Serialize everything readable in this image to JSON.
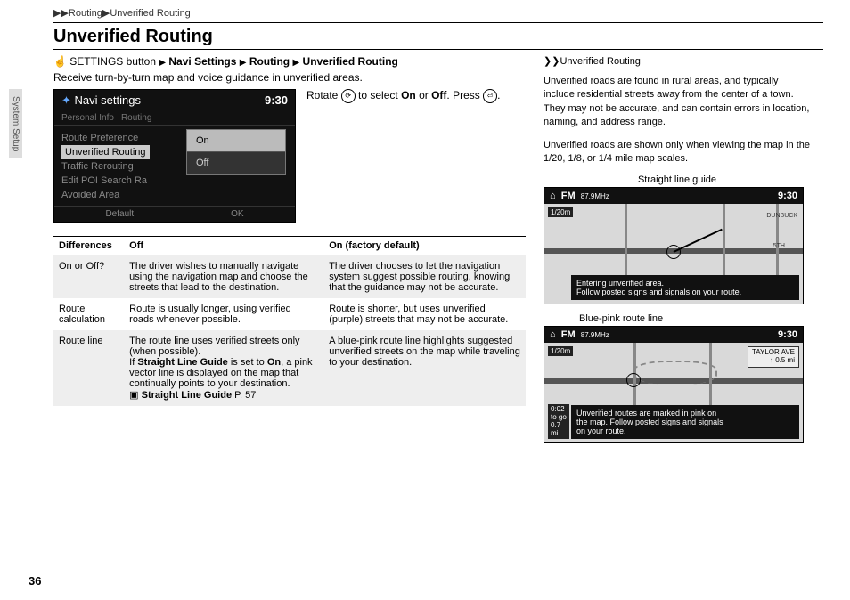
{
  "breadcrumb": {
    "section": "Routing",
    "sub": "Unverified Routing"
  },
  "title": "Unverified Routing",
  "sidetab": "System Setup",
  "path": {
    "prefix": "SETTINGS button",
    "seg1": "Navi Settings",
    "seg2": "Routing",
    "seg3": "Unverified Routing"
  },
  "desc": "Receive turn-by-turn map and voice guidance in unverified areas.",
  "rotate_line": "Rotate     to select On or Off. Press",
  "navi_screen": {
    "title": "Navi settings",
    "clock": "9:30",
    "tab1": "Personal Info",
    "tab2": "Routing",
    "items": [
      "Route Preference",
      "Unverified Routing",
      "Traffic Rerouting",
      "Edit POI Search Ra",
      "Avoided Area"
    ],
    "popup": [
      "On",
      "Off"
    ],
    "foot_left": "Default",
    "foot_right": "OK"
  },
  "table": {
    "headers": [
      "Differences",
      "Off",
      "On (factory default)"
    ],
    "rows": [
      {
        "c1": "On or Off?",
        "c2": "The driver wishes to manually navigate using the navigation map and choose the streets that lead to the destination.",
        "c3": "The driver chooses to let the navigation system suggest possible routing, knowing that the guidance may not be accurate."
      },
      {
        "c1": "Route calculation",
        "c2": "Route is usually longer, using verified roads whenever possible.",
        "c3": "Route is shorter, but uses unverified (purple) streets that may not be accurate."
      },
      {
        "c1": "Route line",
        "c2_a": "The route line uses verified streets only (when possible).",
        "c2_b1": "If ",
        "c2_b2": "Straight Line Guide",
        "c2_b3": " is set to ",
        "c2_b4": "On",
        "c2_b5": ", a pink vector line is displayed on the map that continually points to your destination.",
        "c2_ref": "Straight Line Guide",
        "c2_page": " P. 57",
        "c3": "A blue-pink route line highlights suggested unverified streets on the map while traveling to your destination."
      }
    ]
  },
  "sidebar": {
    "head": "Unverified Routing",
    "para1": "Unverified roads are found in rural areas, and typically include residential streets away from the center of a town. They may not be accurate, and can contain errors in location, naming, and address range.",
    "para2": "Unverified roads are shown only when viewing the map in the 1/20, 1/8, or 1/4 mile map scales.",
    "cap1": "Straight line guide",
    "cap2": "Blue-pink route line",
    "map": {
      "fm": "FM",
      "freq": "87.9MHz",
      "clock": "9:30",
      "scale": "1/20m",
      "overlay1": "Entering unverified area.\nFollow posted signs and signals on your route.",
      "overlay2": "Unverified routes are marked in pink on the map. Follow posted signs and signals on your route.",
      "street2a": "TAYLOR AVE",
      "street2b": "0.5 mi",
      "dist_a": "0:02",
      "dist_b": "to go",
      "dist_c": "0.7",
      "dist_d": "mi",
      "label_dunbuck": "DUNBUCK",
      "label_5th": "5TH"
    }
  },
  "page_number": "36",
  "icons": {
    "hand": "☝",
    "play": "▶",
    "play2": "▶▶",
    "marker": "❯❯",
    "book": "▣"
  }
}
